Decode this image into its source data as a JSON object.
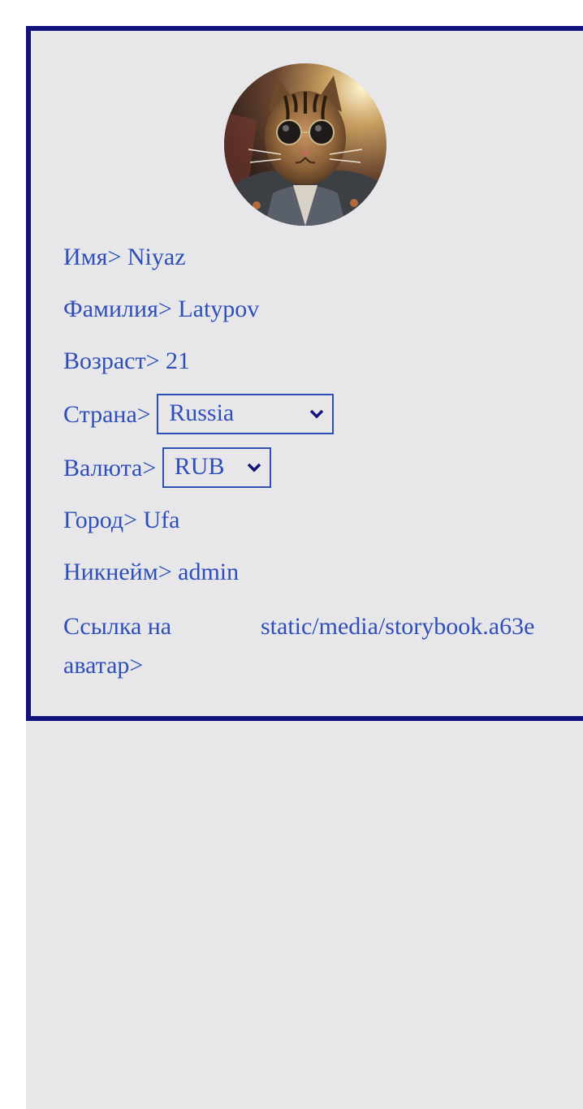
{
  "profile": {
    "avatar": {
      "icon": "avatar-cat-sunglasses-photo",
      "alt": "avatar"
    },
    "first_name": {
      "label": "Имя>",
      "value": "Niyaz"
    },
    "last_name": {
      "label": "Фамилия>",
      "value": "Latypov"
    },
    "age": {
      "label": "Возраст>",
      "value": "21"
    },
    "country": {
      "label": "Страна>",
      "selected": "Russia",
      "icon": "chevron-down-icon"
    },
    "currency": {
      "label": "Валюта>",
      "selected": "RUB",
      "icon": "chevron-down-icon"
    },
    "city": {
      "label": "Город>",
      "value": "Ufa"
    },
    "username": {
      "label": "Никнейм>",
      "value": "admin"
    },
    "avatar_link": {
      "label": "Ссылка на аватар>",
      "value": "static/media/storybook.a63e"
    }
  },
  "colors": {
    "border": "#12127a",
    "text": "#2f4fb8",
    "card_background": "#e7e7ea",
    "page_background": "#ffffff"
  }
}
